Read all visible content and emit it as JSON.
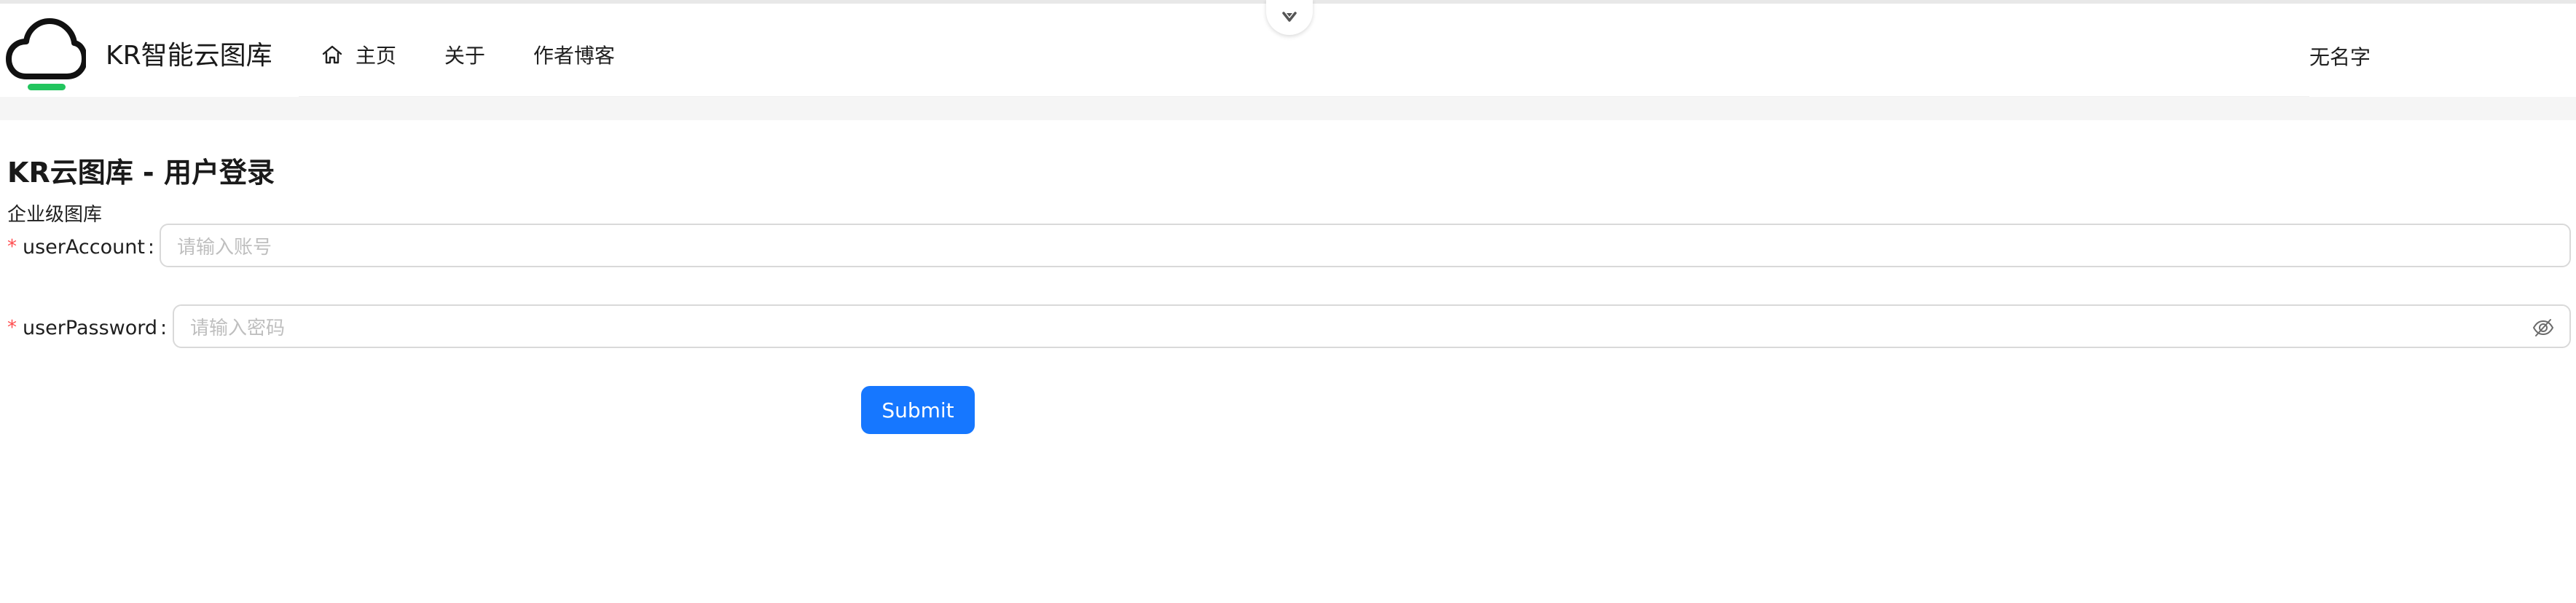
{
  "header": {
    "brand_title": "KR智能云图库",
    "nav": [
      {
        "label": "主页",
        "icon": "home-icon"
      },
      {
        "label": "关于"
      },
      {
        "label": "作者博客"
      }
    ],
    "user_name": "无名字",
    "collapse_icon": "chevron-down-icon"
  },
  "login": {
    "title": "KR云图库 - 用户登录",
    "subtitle": "企业级图库",
    "required_mark": "*",
    "account": {
      "label": "userAccount",
      "colon": ":",
      "placeholder": "请输入账号"
    },
    "password": {
      "label": "userPassword",
      "colon": ":",
      "placeholder": "请输入密码",
      "icon": "eye-invisible-icon"
    },
    "submit_label": "Submit"
  },
  "colors": {
    "primary": "#1677ff",
    "required": "#ff4d4f",
    "logo_accent": "#22c55e",
    "band": "#f5f5f5"
  }
}
